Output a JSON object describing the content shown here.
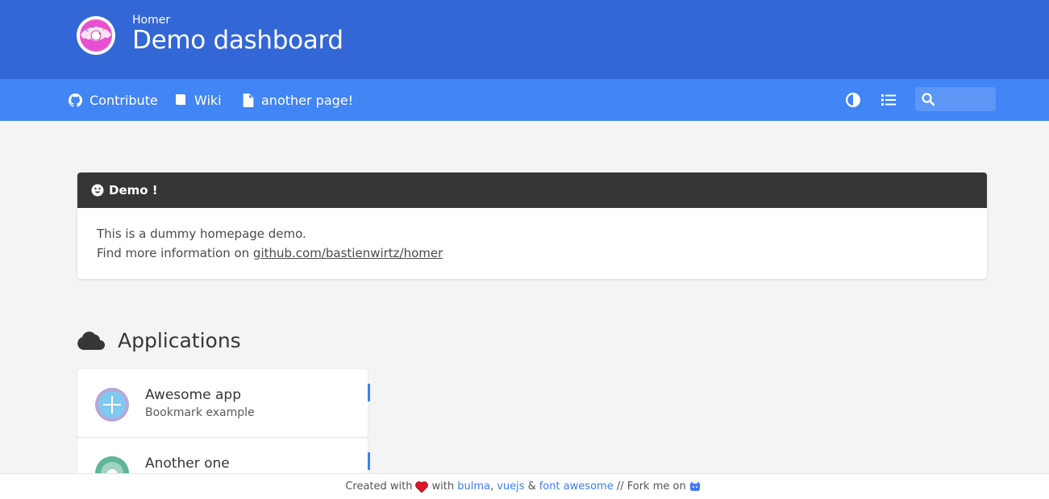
{
  "header": {
    "subtitle": "Homer",
    "title": "Demo dashboard"
  },
  "navbar": {
    "links": [
      {
        "label": "Contribute",
        "icon": "github-icon"
      },
      {
        "label": "Wiki",
        "icon": "book-icon"
      },
      {
        "label": "another page!",
        "icon": "file-icon"
      }
    ],
    "search_value": ""
  },
  "message": {
    "title": "Demo !",
    "line1": "This is a dummy homepage demo.",
    "line2_prefix": "Find more information on ",
    "link": "github.com/bastienwirtz/homer"
  },
  "applications": {
    "title": "Applications",
    "items": [
      {
        "name": "Awesome app",
        "subtitle": "Bookmark example"
      },
      {
        "name": "Another one",
        "subtitle": ""
      }
    ]
  },
  "footer": {
    "created": "Created with",
    "with": "with",
    "bulma": "bulma",
    "comma": ",",
    "vuejs": "vuejs",
    "amp": "&",
    "fa": "font awesome",
    "fork": "// Fork me on"
  },
  "colors": {
    "header": "#3367d6",
    "navbar": "#4285f4",
    "accent": "#3e7df3",
    "message_header": "#363636"
  }
}
